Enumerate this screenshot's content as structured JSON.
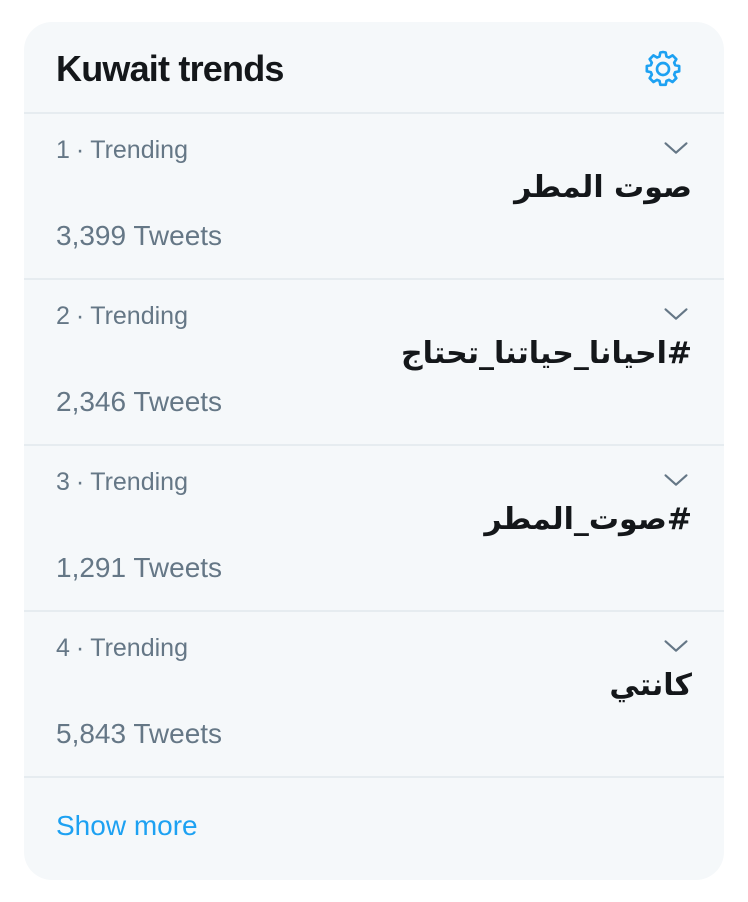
{
  "header": {
    "title": "Kuwait trends",
    "settings_icon": "gear-icon",
    "accent_color": "#1da1f2"
  },
  "trends": [
    {
      "rank": "1",
      "separator": "·",
      "context": "Trending",
      "name": "صوت المطر",
      "tweets": "3,399 Tweets"
    },
    {
      "rank": "2",
      "separator": "·",
      "context": "Trending",
      "name": "#احيانا_حياتنا_تحتاج",
      "tweets": "2,346 Tweets"
    },
    {
      "rank": "3",
      "separator": "·",
      "context": "Trending",
      "name": "#صوت_المطر",
      "tweets": "1,291 Tweets"
    },
    {
      "rank": "4",
      "separator": "·",
      "context": "Trending",
      "name": "كانتي",
      "tweets": "5,843 Tweets"
    }
  ],
  "footer": {
    "show_more": "Show more"
  }
}
